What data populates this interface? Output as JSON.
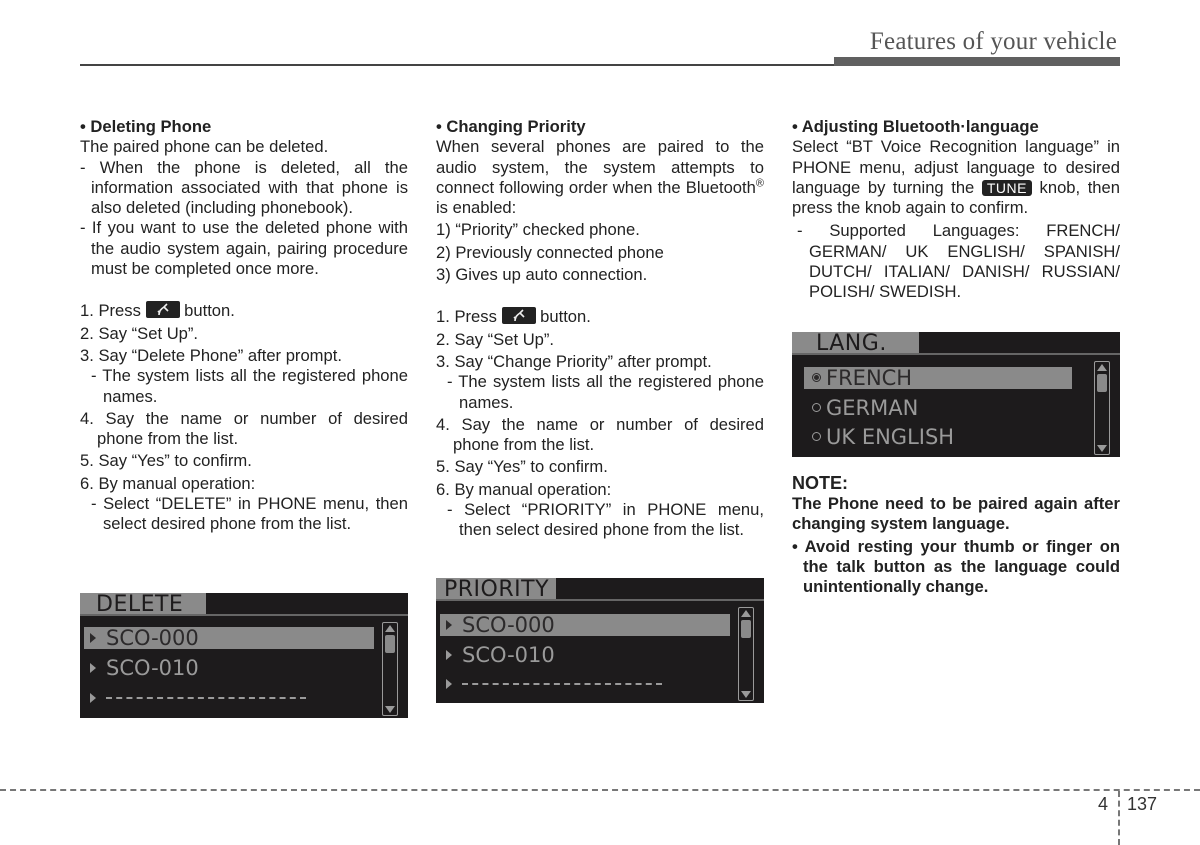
{
  "header": {
    "section_title": "Features of your vehicle"
  },
  "deleting": {
    "heading": "• Deleting Phone",
    "intro": "The paired phone can be deleted.",
    "notes": [
      "- When the phone is deleted, all the information associated with that phone is also deleted (including phonebook).",
      "- If you want to use the deleted phone with the audio system again, pairing procedure must be completed once more."
    ],
    "step1_pre": "1. Press",
    "step1_post": "button.",
    "step2": "2. Say “Set Up”.",
    "step3": "3. Say “Delete Phone” after prompt.",
    "step3_note": "- The system lists all the registered phone names.",
    "step4": "4. Say the name or number of desired phone from the list.",
    "step5": "5. Say “Yes” to confirm.",
    "step6": "6. By manual operation:",
    "step6_note": "- Select “DELETE” in PHONE menu, then select desired phone from the list.",
    "screen": {
      "tab": "DELETE",
      "rows": [
        "SCO-000",
        "SCO-010",
        ""
      ],
      "selected_index": 0
    }
  },
  "priority": {
    "heading": "• Changing Priority",
    "intro_pre": "When several phones are paired to the audio system, the system attempts to connect following order when the Bluetooth",
    "intro_reg": "®",
    "intro_post": " is enabled:",
    "order": [
      "1) “Priority” checked phone.",
      "2) Previously connected phone",
      "3) Gives up auto connection."
    ],
    "step1_pre": "1. Press",
    "step1_post": "button.",
    "step2": "2. Say “Set Up”.",
    "step3": "3. Say “Change Priority” after prompt.",
    "step3_note": "- The system lists all the registered phone names.",
    "step4": "4. Say the name or number of desired phone from the list.",
    "step5": "5. Say “Yes” to confirm.",
    "step6": "6. By manual operation:",
    "step6_note": "- Select “PRIORITY” in PHONE menu, then select desired phone from the list.",
    "screen": {
      "tab": "PRIORITY",
      "rows": [
        "SCO-000",
        "SCO-010",
        ""
      ],
      "selected_index": 0
    }
  },
  "language": {
    "heading": "• Adjusting Bluetooth·language",
    "intro_pre": "Select “BT Voice Recognition language” in PHONE menu, adjust language to desired language by turning the",
    "tune_label": "TUNE",
    "intro_post": "knob, then press the knob again to confirm.",
    "supported": "- Supported Languages: FRENCH/ GERMAN/ UK ENGLISH/ SPANISH/ DUTCH/ ITALIAN/ DANISH/ RUSSIAN/ POLISH/ SWEDISH.",
    "screen": {
      "tab": "LANG.",
      "rows": [
        "FRENCH",
        "GERMAN",
        "UK ENGLISH"
      ],
      "selected_index": 0
    },
    "note_heading": "NOTE:",
    "note_text": "The Phone need to be paired again after changing system language.",
    "note_bullet": "• Avoid resting your thumb or finger on the talk button as the language could unintentionally change."
  },
  "footer": {
    "chapter": "4",
    "page": "137"
  }
}
